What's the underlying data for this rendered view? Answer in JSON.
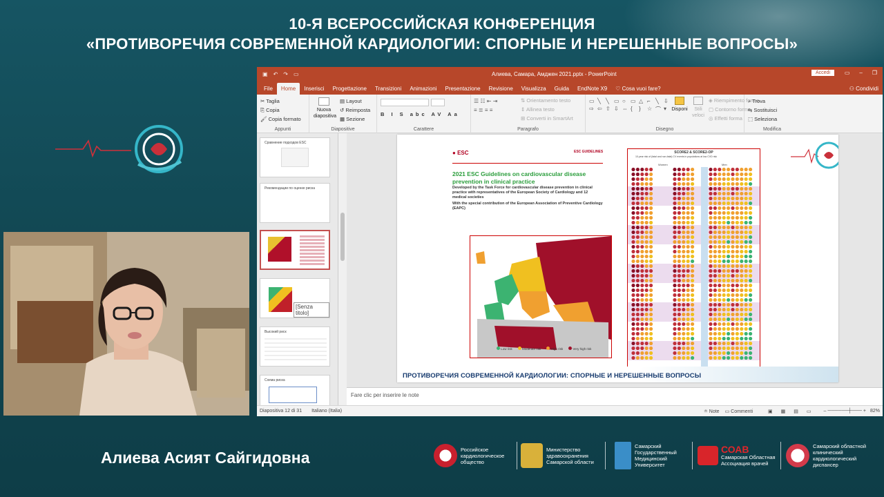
{
  "conference": {
    "line1": "10-Я ВСЕРОССИЙСКАЯ КОНФЕРЕНЦИЯ",
    "line2": "«ПРОТИВОРЕЧИЯ СОВРЕМЕННОЙ КАРДИОЛОГИИ: СПОРНЫЕ И НЕРЕШЕННЫЕ ВОПРОСЫ»"
  },
  "speaker": {
    "name": "Алиева Асият Сайгидовна"
  },
  "ppt": {
    "window_title": "Алиева, Самара, Амджен 2021.pptx - PowerPoint",
    "signin": "Accedi",
    "tabs": [
      "File",
      "Home",
      "Inserisci",
      "Progettazione",
      "Transizioni",
      "Animazioni",
      "Presentazione",
      "Revisione",
      "Visualizza",
      "Guida",
      "EndNote X9"
    ],
    "active_tab": "Home",
    "tell_me": "Cosa vuoi fare?",
    "share": "Condividi",
    "ribbon": {
      "clipboard": {
        "label": "Appunti",
        "cut": "Taglia",
        "copy": "Copia",
        "format": "Copia formato"
      },
      "slides": {
        "label": "Diapositive",
        "new": "Nuova diapositiva",
        "layout": "Layout",
        "reset": "Reimposta",
        "section": "Sezione"
      },
      "font": {
        "label": "Carattere"
      },
      "paragraph": {
        "label": "Paragrafo",
        "orient": "Orientamento testo",
        "align": "Allinea testo",
        "smartart": "Converti in SmartArt"
      },
      "drawing": {
        "label": "Disegno",
        "arrange": "Disponi",
        "styles": "Stili veloci",
        "fill": "Riempimento forma",
        "outline": "Contorno forma",
        "effects": "Effetti forma"
      },
      "editing": {
        "label": "Modifica",
        "find": "Trova",
        "replace": "Sostituisci",
        "select": "Seleziona"
      }
    },
    "thumb_labels": [
      "Сравнение подходов ESC",
      "Рекомендации по оценке риска",
      "2021 ESC Guidelines",
      "Senza titolo",
      "Высокий риск",
      "Схема риска"
    ],
    "thumb_tooltip": "[Senza titolo]",
    "notes_placeholder": "Fare clic per inserire le note",
    "status": {
      "slide": "Diapositiva 12 di 31",
      "language": "Italiano (Italia)",
      "notes": "Note",
      "comments": "Commenti",
      "zoom": "82%"
    }
  },
  "slide": {
    "esc_logo": "ESC",
    "esc_guidelines": "ESC GUIDELINES",
    "title": "2021 ESC Guidelines on cardiovascular disease prevention in clinical practice",
    "subtitle": "Developed by the Task Force for cardiovascular disease prevention in clinical practice with representatives of the European Society of Cardiology and 12 medical societies",
    "subtitle2": "With the special contribution of the European Association of Preventive Cardiology (EAPC)",
    "legend": [
      "Low risk",
      "Moderate risk",
      "High risk",
      "Very high risk"
    ],
    "legend_colors": [
      "#3cb371",
      "#f0c020",
      "#f0a030",
      "#a0102a"
    ],
    "score_title": "SCORE2 & SCORE2-OP",
    "score_sub": "10-year risk of (fatal and non-fatal) CV events in populations at low CVD risk",
    "women": "Women",
    "men": "Men",
    "footer": "ПРОТИВОРЕЧИЯ СОВРЕМЕННОЙ КАРДИОЛОГИИ: СПОРНЫЕ И НЕРЕШЕННЫЕ ВОПРОСЫ"
  },
  "partners": [
    {
      "name": "Российское кардиологическое общество",
      "color": "#c8202e"
    },
    {
      "name": "Министерство здравоохранения Самарской области",
      "color": "#d9b13a"
    },
    {
      "name": "Самарский Государственный Медицинский Университет",
      "color": "#3a8ec8"
    },
    {
      "name": "Самарская Областная Ассоциация врачей",
      "color": "#d8252a",
      "abbr": "СОАВ"
    },
    {
      "name": "Самарский областной клинический кардиологический диспансер",
      "color": "#d33a4a"
    }
  ]
}
